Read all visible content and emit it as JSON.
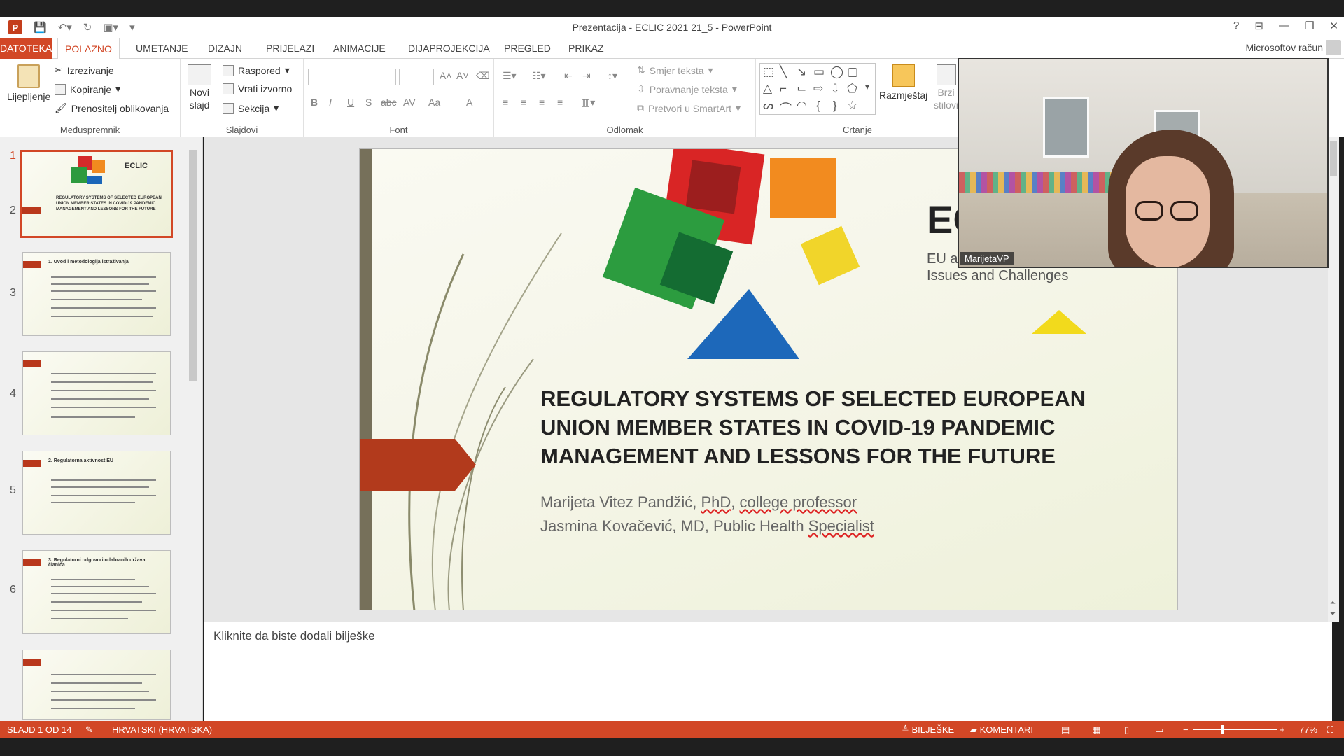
{
  "window": {
    "title": "Prezentacija - ECLIC 2021 21_5 - PowerPoint",
    "app_icon": "P",
    "help": "?",
    "account": "Microsoftov račun"
  },
  "tabs": [
    "DATOTEKA",
    "POLAZNO",
    "UMETANJE",
    "DIZAJN",
    "PRIJELAZI",
    "ANIMACIJE",
    "DIJAPROJEKCIJA",
    "PREGLED",
    "PRIKAZ"
  ],
  "ribbon": {
    "clipboard": {
      "label": "Međuspremnik",
      "paste": "Lijepljenje",
      "cut": "Izrezivanje",
      "copy": "Kopiranje",
      "format_painter": "Prenositelj oblikovanja"
    },
    "slides": {
      "label": "Slajdovi",
      "new_slide_1": "Novi",
      "new_slide_2": "slajd",
      "layout": "Raspored",
      "reset": "Vrati izvorno",
      "section": "Sekcija"
    },
    "font": {
      "label": "Font",
      "bold": "B",
      "italic": "I",
      "underline": "U",
      "shadow": "S",
      "strike": "abc",
      "spacing": "AV",
      "case": "Aa",
      "color": "A"
    },
    "paragraph": {
      "label": "Odlomak",
      "direction": "Smjer teksta",
      "align": "Poravnanje teksta",
      "smartart": "Pretvori u SmartArt"
    },
    "drawing": {
      "label": "Crtanje",
      "arrange": "Razmještaj",
      "quick_styles_1": "Brzi",
      "quick_styles_2": "stilovi"
    }
  },
  "thumbnails": [
    {
      "num": "1",
      "head": "ECLIC",
      "title": "REGULATORY SYSTEMS OF SELECTED EUROPEAN UNION MEMBER STATES IN COVID-19 PANDEMIC MANAGEMENT AND LESSONS FOR THE FUTURE"
    },
    {
      "num": "2",
      "head": "1. Uvod i metodologija istraživanja"
    },
    {
      "num": "3",
      "head": ""
    },
    {
      "num": "4",
      "head": "2. Regulatorna aktivnost EU"
    },
    {
      "num": "5",
      "head": "3. Regulatorni odgovori odabranih država članica"
    },
    {
      "num": "6",
      "head": ""
    }
  ],
  "slide": {
    "logo_text": "EC",
    "tagline1": "EU a",
    "tagline2": "Issues and Challenges",
    "title": "REGULATORY SYSTEMS OF SELECTED EUROPEAN UNION MEMBER STATES IN COVID-19 PANDEMIC MANAGEMENT AND LESSONS FOR THE FUTURE",
    "author1_a": "Marijeta Vitez Pandžić, ",
    "author1_b": "PhD",
    "author1_c": ", ",
    "author1_d": "college professor",
    "author2_a": "Jasmina Kovačević, MD, Public Health ",
    "author2_b": "Specialist"
  },
  "notes_placeholder": "Kliknite da biste dodali bilješke",
  "video": {
    "name": "MarijetaVP"
  },
  "status": {
    "slide": "SLAJD 1 OD 14",
    "language": "HRVATSKI (HRVATSKA)",
    "notes": "BILJEŠKE",
    "comments": "KOMENTARI",
    "zoom": "77%"
  }
}
